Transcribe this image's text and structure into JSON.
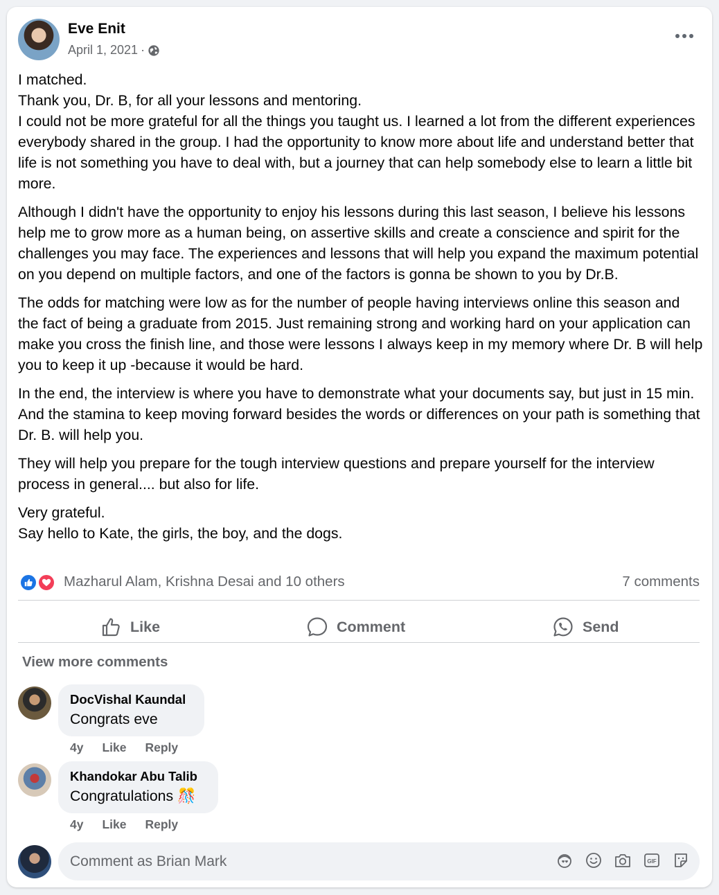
{
  "post": {
    "author": "Eve Enit",
    "date": "April 1, 2021",
    "separator": "·",
    "privacy_icon": "globe-icon",
    "more_icon": "more-options-icon",
    "paragraphs": [
      "I matched.\nThank you, Dr. B, for all your lessons and mentoring.\nI could not be more grateful for all the things you taught us. I learned a lot from the different experiences everybody shared in the group. I had the opportunity to know more about life and understand better that life is not something you have to deal with, but a journey that can help somebody else to learn a little bit more.",
      "Although I didn't have the opportunity to enjoy his lessons during this last season, I believe his lessons help me to grow more as a human being, on assertive skills and create a conscience and spirit for the challenges you may face. The experiences and lessons that will help you expand the maximum potential on you depend on multiple factors, and one of the factors is gonna be shown to you by Dr.B.",
      "The odds for matching were low as for the number of people having interviews online this season and the fact of being a graduate from 2015. Just remaining strong and working hard on your application can make you cross the finish line, and those were lessons I always keep in my memory where Dr. B will help you to keep it up -because it would be hard.",
      "In the end, the interview is where you have to demonstrate what your documents say, but just in 15 min. And the stamina to keep moving forward besides the words or differences on your path is something that Dr. B. will help you.",
      "They will help you prepare for the tough interview questions and prepare yourself for the interview process in general.... but also for life.",
      "Very grateful.\nSay hello to Kate, the girls, the boy, and the dogs."
    ]
  },
  "reactions": {
    "names": "Mazharul Alam, Krishna Desai and 10 others",
    "comments_count": "7 comments",
    "icons": [
      "like-reaction-icon",
      "love-reaction-icon"
    ]
  },
  "actions": {
    "like": "Like",
    "comment": "Comment",
    "send": "Send"
  },
  "view_more": "View more comments",
  "comments": [
    {
      "name": "DocVishal Kaundal",
      "text": "Congrats eve",
      "time": "4y",
      "like": "Like",
      "reply": "Reply"
    },
    {
      "name": "Khandokar Abu Talib",
      "text": "Congratulations 🎊",
      "time": "4y",
      "like": "Like",
      "reply": "Reply"
    }
  ],
  "composer": {
    "placeholder": "Comment as Brian Mark",
    "tools": [
      "avatar-sticker-icon",
      "emoji-icon",
      "camera-icon",
      "gif-icon",
      "sticker-icon"
    ]
  },
  "colors": {
    "like_blue": "#1b74e4",
    "love_red": "#f33e58",
    "secondary_text": "#65676b",
    "bubble_bg": "#f0f2f5"
  }
}
